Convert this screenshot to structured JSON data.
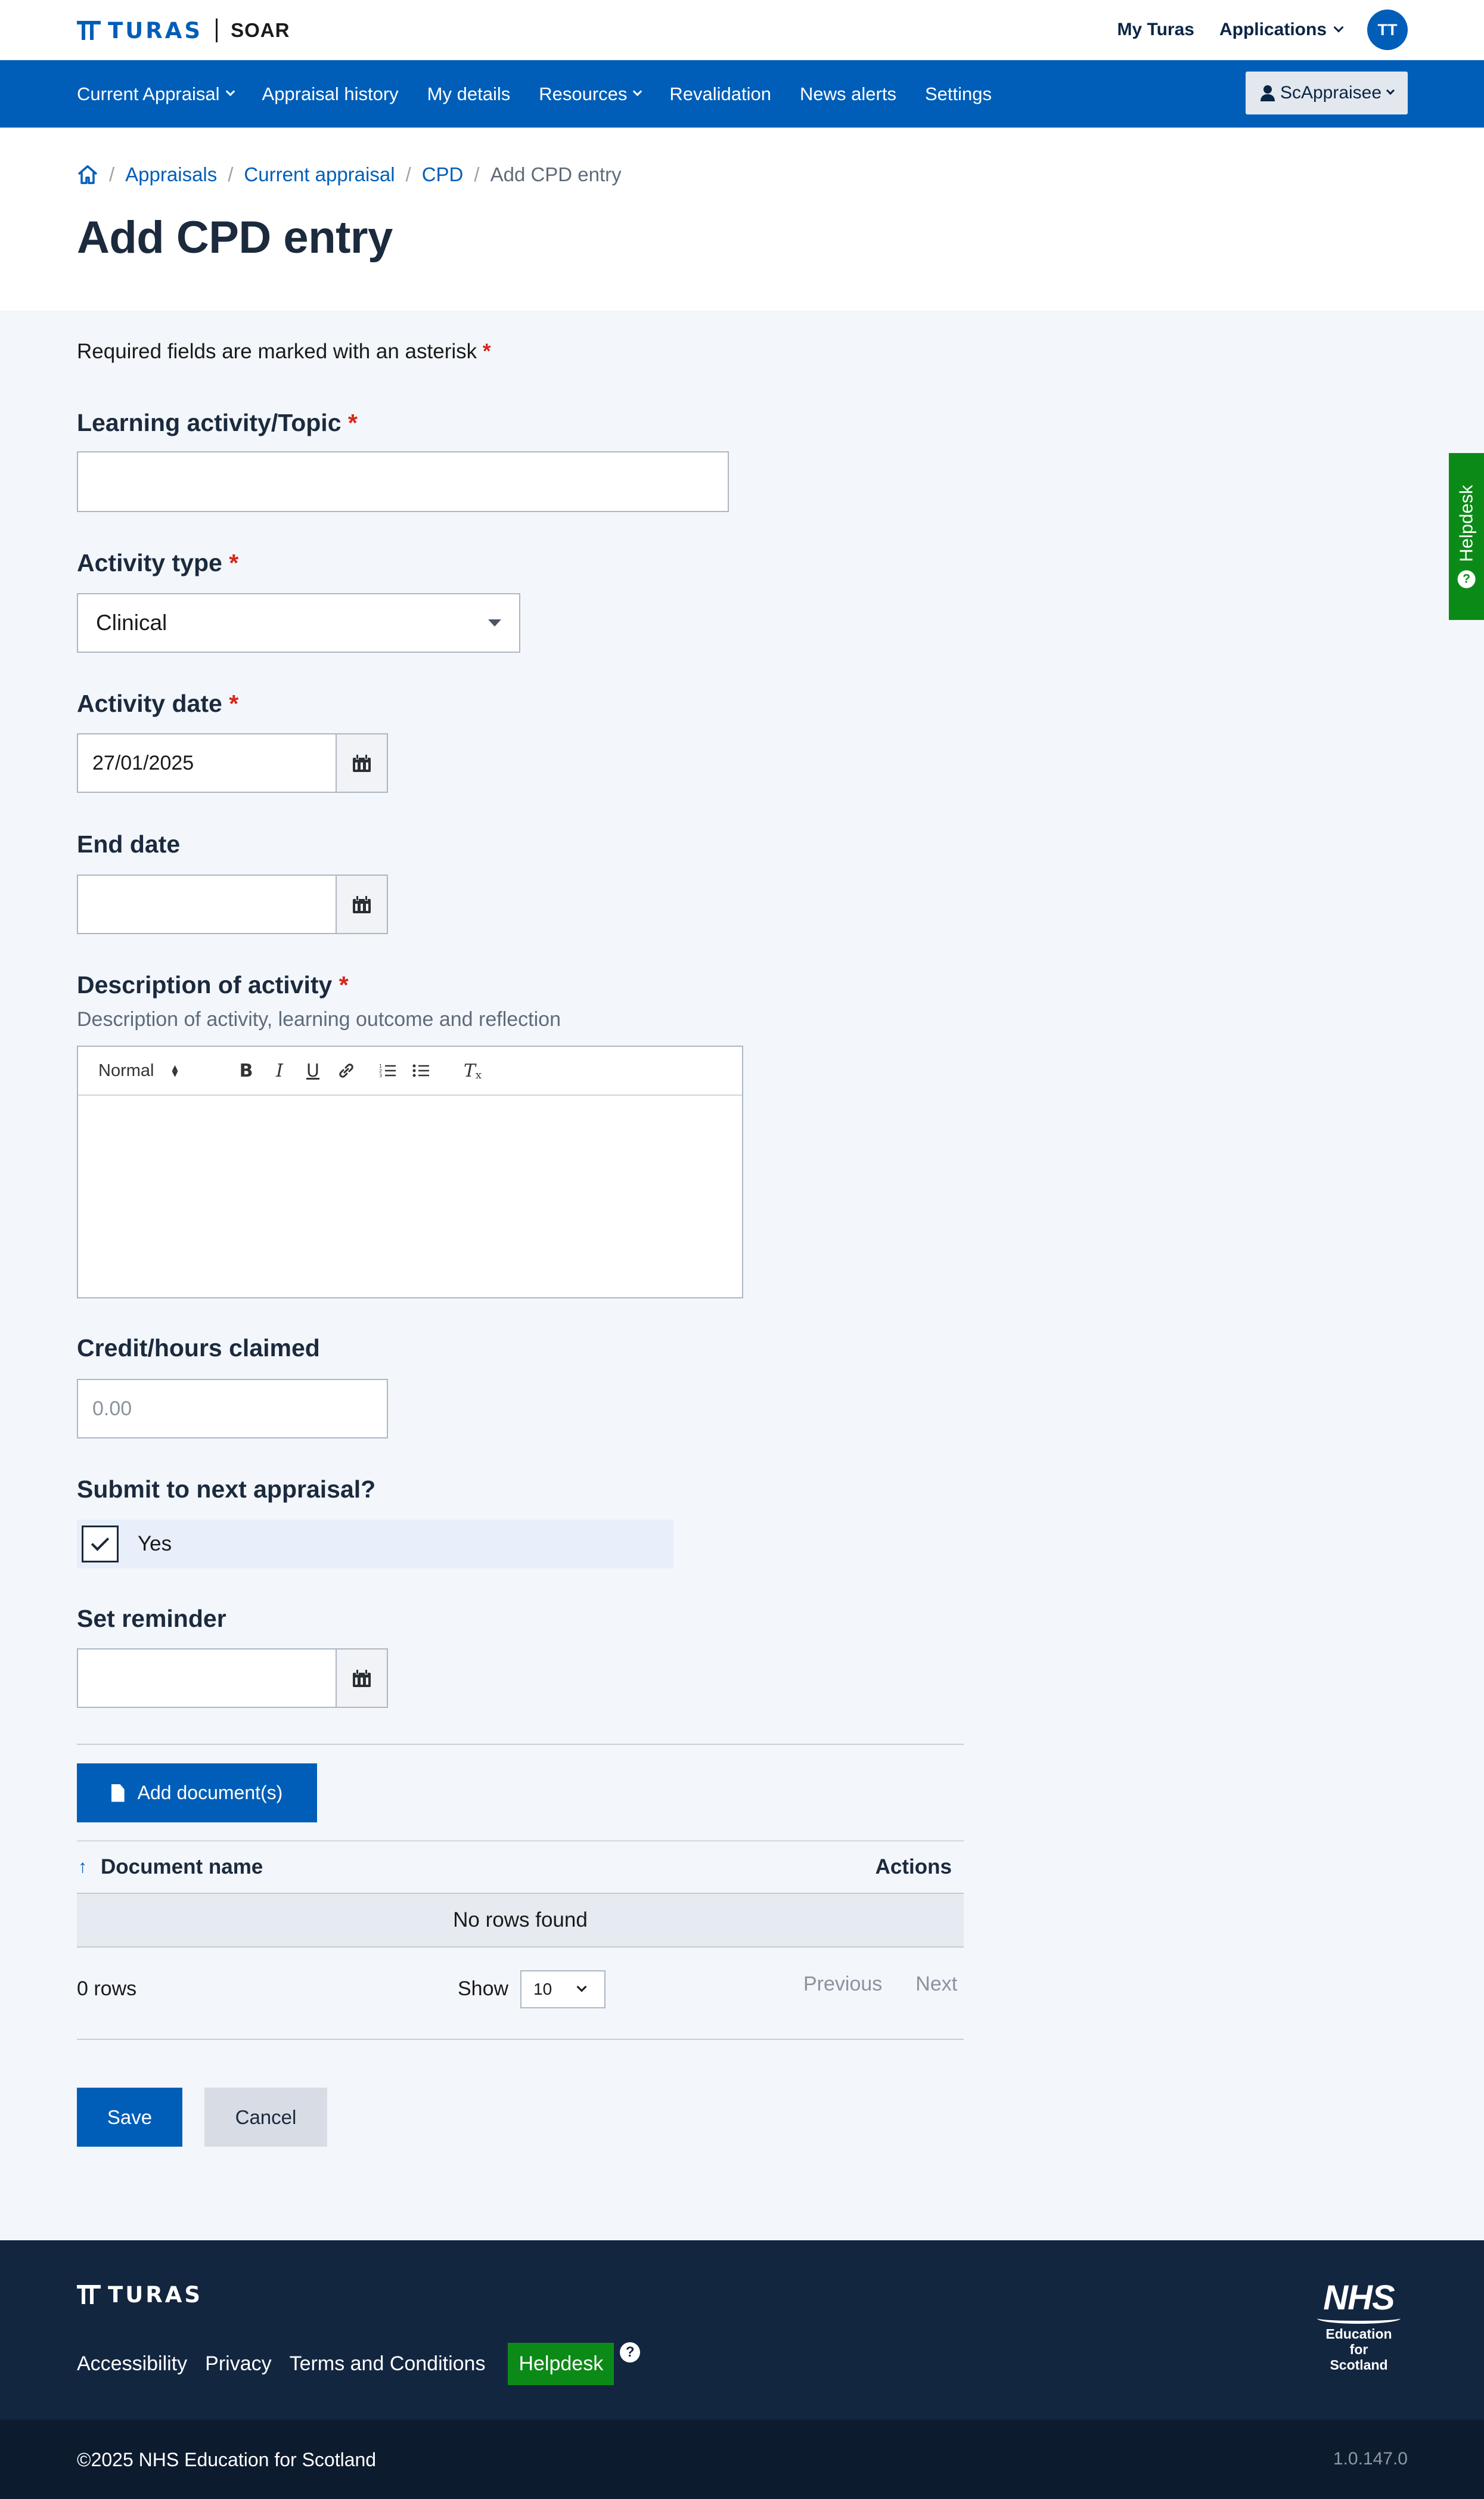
{
  "header": {
    "logo_text": "TURAS",
    "app_name": "SOAR",
    "links": [
      "My Turas",
      "Applications"
    ],
    "avatar_initials": "TT"
  },
  "nav": {
    "items": [
      {
        "label": "Current Appraisal",
        "dropdown": true
      },
      {
        "label": "Appraisal history",
        "dropdown": false
      },
      {
        "label": "My details",
        "dropdown": false
      },
      {
        "label": "Resources",
        "dropdown": true
      },
      {
        "label": "Revalidation",
        "dropdown": false
      },
      {
        "label": "News alerts",
        "dropdown": false
      },
      {
        "label": "Settings",
        "dropdown": false
      }
    ],
    "user": "ScAppraisee"
  },
  "breadcrumb": [
    "Appraisals",
    "Current appraisal",
    "CPD",
    "Add CPD entry"
  ],
  "page_title": "Add CPD entry",
  "form": {
    "required_note": "Required fields are marked with an asterisk",
    "asterisk": "*",
    "topic_label": "Learning activity/Topic",
    "topic_value": "",
    "type_label": "Activity type",
    "type_value": "Clinical",
    "date_label": "Activity date",
    "date_value": "27/01/2025",
    "end_date_label": "End date",
    "end_date_value": "",
    "desc_label": "Description of activity",
    "desc_hint": "Description of activity, learning outcome and reflection",
    "editor_format": "Normal",
    "credit_label": "Credit/hours claimed",
    "credit_placeholder": "0.00",
    "submit_label": "Submit to next appraisal?",
    "submit_option": "Yes",
    "submit_checked": true,
    "reminder_label": "Set reminder",
    "reminder_value": ""
  },
  "documents": {
    "add_button": "Add document(s)",
    "col_name": "Document name",
    "col_actions": "Actions",
    "empty": "No rows found",
    "rows_info": "0 rows",
    "show_label": "Show",
    "page_size": "10",
    "prev": "Previous",
    "next": "Next"
  },
  "actions": {
    "save": "Save",
    "cancel": "Cancel"
  },
  "helpdesk_tab": "Helpdesk",
  "footer": {
    "logo_text": "TURAS",
    "links": [
      "Accessibility",
      "Privacy",
      "Terms and Conditions"
    ],
    "helpdesk": "Helpdesk",
    "nhs_logo": {
      "mark": "NHS",
      "lines": [
        "Education",
        "for",
        "Scotland"
      ]
    },
    "copyright": "©2025 NHS Education for Scotland",
    "version": "1.0.147.0"
  },
  "colors": {
    "primary": "#005eb8",
    "helpdesk_green": "#0c8a17",
    "footer": "#132640",
    "required": "#d5281b"
  }
}
